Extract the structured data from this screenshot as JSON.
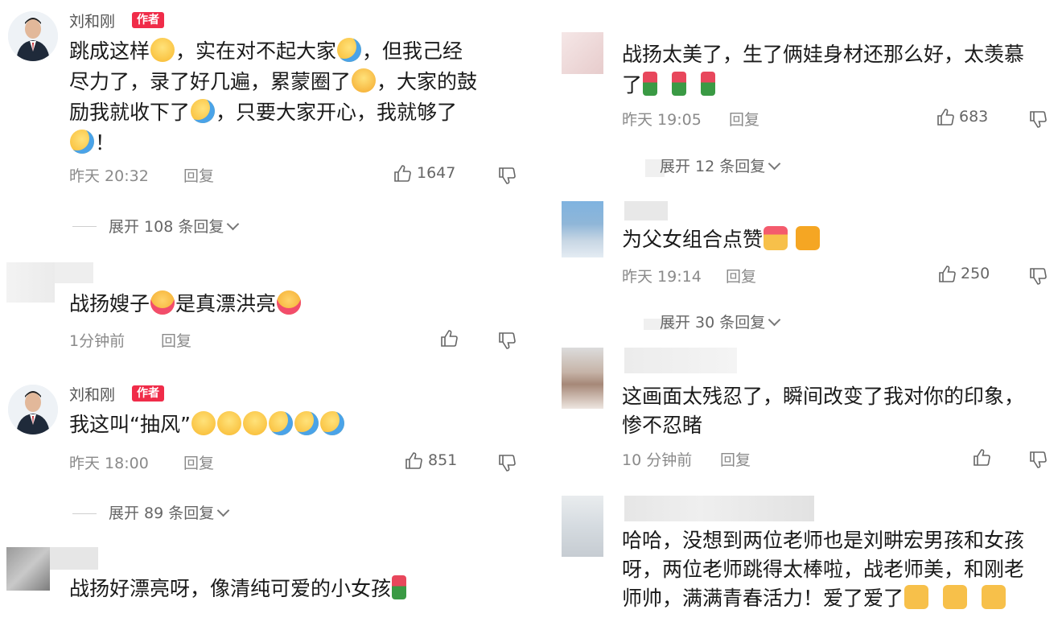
{
  "left": {
    "c1": {
      "author": "刘和刚",
      "badge": "作者",
      "lines": [
        "跳成这样",
        "，实在对不起大家",
        "，但我己经",
        "尽力了，录了好几遍，累蒙圈了",
        "，大家的鼓",
        "励我就收下了",
        "，只要大家开心，我就够了",
        "！"
      ],
      "time": "昨天 20:32",
      "reply": "回复",
      "likes": "1647",
      "expand": "展开 108 条回复"
    },
    "c2": {
      "text_a": "战扬嫂子",
      "text_b": "是真漂洪亮",
      "time": "1分钟前",
      "reply": "回复"
    },
    "c3": {
      "author": "刘和刚",
      "badge": "作者",
      "text": "我这叫“抽风”",
      "time": "昨天 18:00",
      "reply": "回复",
      "likes": "851",
      "expand": "展开 89 条回复"
    },
    "c4": {
      "text": "战扬好漂亮呀，像清纯可爱的小女孩"
    }
  },
  "right": {
    "c1": {
      "line1": "战扬太美了，生了俩娃身材还那么好，太羡慕",
      "line2": "了",
      "time": "昨天 19:05",
      "reply": "回复",
      "likes": "683",
      "expand": "展开 12 条回复"
    },
    "c2": {
      "text": "为父女组合点赞",
      "time": "昨天 19:14",
      "reply": "回复",
      "likes": "250",
      "expand": "展开 30 条回复"
    },
    "c3": {
      "line1": "这画面太残忍了，瞬间改变了我对你的印象，",
      "line2": "惨不忍睹",
      "time": "10 分钟前",
      "reply": "回复"
    },
    "c4": {
      "line1": "哈哈，没想到两位老师也是刘畊宏男孩和女孩",
      "line2": "呀，两位老师跳得太棒啦，战老师美，和刚老",
      "line3": "师帅，满满青春活力！爱了爱了"
    }
  },
  "colors": {
    "badge": "#f02c49",
    "meta": "#8a8a8a",
    "text": "#1a1a1a"
  }
}
